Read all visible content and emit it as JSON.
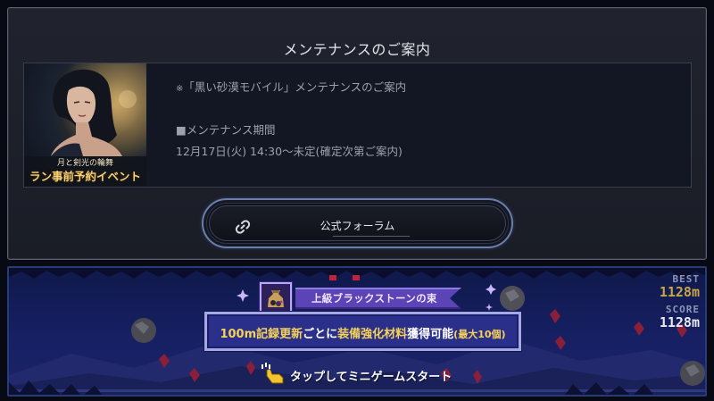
{
  "dialog": {
    "title": "メンテナンスのご案内",
    "banner": {
      "subtitle": "月と剣光の輪舞",
      "title": "ラン事前予約イベント"
    },
    "notice": {
      "mark": "※",
      "line1": "「黒い砂漠モバイル」メンテナンスのご案内",
      "line2": "■メンテナンス期間",
      "line3": "12月17日(火) 14:30～未定(確定次第ご案内)"
    },
    "forum_button": {
      "label": "公式フォーラム",
      "icon": "link-icon"
    }
  },
  "minigame": {
    "reward": {
      "icon": "black-stone-bag-icon",
      "label": "上級ブラックストーンの束"
    },
    "record": {
      "part1": "100m記録更新",
      "part2": "ごとに",
      "part3": "装備強化材料",
      "part4": "獲得可能",
      "part5": "(最大10個)"
    },
    "tap": {
      "icon": "tap-hand-icon",
      "label": "タップしてミニゲームスタート"
    },
    "score": {
      "best_label": "BEST",
      "best_value": "1128m",
      "score_label": "SCORE",
      "score_value": "1128m"
    }
  },
  "colors": {
    "dialog_bg": "#1d2029",
    "button_border": "#6a7ea8",
    "game_bg": "#162063",
    "record_highlight": "#f5d25a",
    "ribbon": "#5b44b5"
  }
}
